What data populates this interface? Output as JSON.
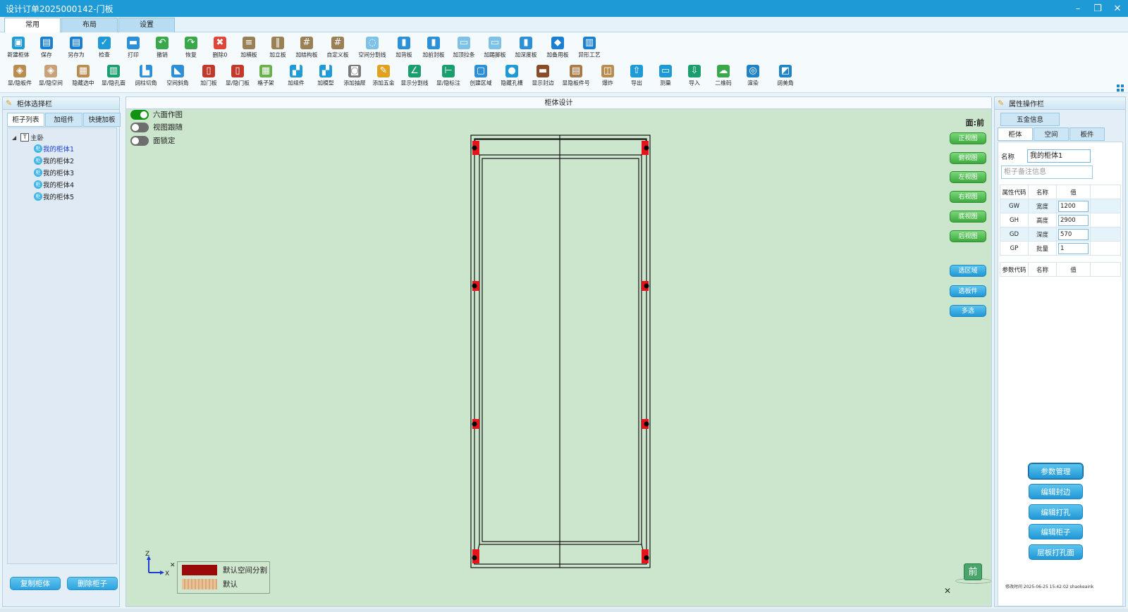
{
  "window": {
    "title": "设计订单2025000142-门板",
    "controls": [
      "–",
      "❐",
      "✕"
    ]
  },
  "ribbon_tabs": [
    "常用",
    "布局",
    "设置"
  ],
  "toolbar_row1": [
    {
      "label": "新建柜体",
      "icon": "new-cabinet-icon",
      "glyph": "▣",
      "color": "#1e9ad6"
    },
    {
      "label": "保存",
      "icon": "save-icon",
      "glyph": "▤",
      "color": "#1a7fd0"
    },
    {
      "label": "另存为",
      "icon": "save-as-icon",
      "glyph": "▤",
      "color": "#1a7fd0"
    },
    {
      "label": "检查",
      "icon": "check-icon",
      "glyph": "✓",
      "color": "#1e9ad6"
    },
    {
      "label": "打印",
      "icon": "print-icon",
      "glyph": "▬",
      "color": "#2d8fd6"
    },
    {
      "label": "撤销",
      "icon": "undo-icon",
      "glyph": "↶",
      "color": "#3aa84a"
    },
    {
      "label": "恢复",
      "icon": "redo-icon",
      "glyph": "↷",
      "color": "#3aa84a"
    },
    {
      "label": "删除0",
      "icon": "delete-icon",
      "glyph": "✖",
      "color": "#e0473a"
    },
    {
      "label": "加横板",
      "icon": "add-horizontal-board-icon",
      "glyph": "≡",
      "color": "#9a8055"
    },
    {
      "label": "加立板",
      "icon": "add-vertical-board-icon",
      "glyph": "‖",
      "color": "#9a8055"
    },
    {
      "label": "加结构板",
      "icon": "add-structure-board-icon",
      "glyph": "#",
      "color": "#9a8055"
    },
    {
      "label": "自定义板",
      "icon": "custom-board-icon",
      "glyph": "#",
      "color": "#9a8055"
    },
    {
      "label": "空间分割线",
      "icon": "space-divider-icon",
      "glyph": "◌",
      "color": "#7fc2e8"
    },
    {
      "label": "加背板",
      "icon": "add-back-board-icon",
      "glyph": "▮",
      "color": "#2d8fd6"
    },
    {
      "label": "加前封板",
      "icon": "add-front-seal-icon",
      "glyph": "▮",
      "color": "#2d8fd6"
    },
    {
      "label": "加顶拉条",
      "icon": "add-top-strip-icon",
      "glyph": "▭",
      "color": "#7fc2e8"
    },
    {
      "label": "加踢脚板",
      "icon": "add-skirting-icon",
      "glyph": "▭",
      "color": "#7fc2e8"
    },
    {
      "label": "加深度板",
      "icon": "add-depth-board-icon",
      "glyph": "▮",
      "color": "#2d8fd6"
    },
    {
      "label": "加备用板",
      "icon": "add-spare-board-icon",
      "glyph": "◆",
      "color": "#1a7fd0"
    },
    {
      "label": "异形工艺",
      "icon": "special-shape-icon",
      "glyph": "▥",
      "color": "#1a7fd0"
    }
  ],
  "toolbar_row2": [
    {
      "label": "显/隐板件",
      "icon": "toggle-boards-icon",
      "glyph": "◈",
      "color": "#b98c4f"
    },
    {
      "label": "显/隐空间",
      "icon": "toggle-space-icon",
      "glyph": "◈",
      "color": "#c9a27a"
    },
    {
      "label": "隐藏选中",
      "icon": "hide-selected-icon",
      "glyph": "▦",
      "color": "#b98c4f"
    },
    {
      "label": "显/隐孔面",
      "icon": "toggle-hole-face-icon",
      "glyph": "▥",
      "color": "#1a9e6e"
    },
    {
      "label": "阔柱切角",
      "icon": "column-chamfer-icon",
      "glyph": "▙",
      "color": "#2d8fd6"
    },
    {
      "label": "空间斜角",
      "icon": "space-bevel-icon",
      "glyph": "◣",
      "color": "#2d8fd6"
    },
    {
      "label": "加门板",
      "icon": "add-door-icon",
      "glyph": "▯",
      "color": "#c0392b"
    },
    {
      "label": "显/隐门板",
      "icon": "toggle-door-icon",
      "glyph": "▯",
      "color": "#c0392b"
    },
    {
      "label": "格子架",
      "icon": "grid-shelf-icon",
      "glyph": "▦",
      "color": "#6ab04c"
    },
    {
      "label": "加组件",
      "icon": "add-component-icon",
      "glyph": "▞",
      "color": "#1e9ad6"
    },
    {
      "label": "加模型",
      "icon": "add-model-icon",
      "glyph": "▞",
      "color": "#1e9ad6"
    },
    {
      "label": "添加抽屉",
      "icon": "add-drawer-icon",
      "glyph": "◙",
      "color": "#7a7a7a"
    },
    {
      "label": "添加五金",
      "icon": "add-hardware-icon",
      "glyph": "✎",
      "color": "#e0a020"
    },
    {
      "label": "显示分割线",
      "icon": "show-divider-icon",
      "glyph": "∠",
      "color": "#1a9e6e"
    },
    {
      "label": "显/隐标注",
      "icon": "toggle-dimension-icon",
      "glyph": "⊢",
      "color": "#1a9e6e"
    },
    {
      "label": "创建区域",
      "icon": "create-area-icon",
      "glyph": "▢",
      "color": "#2d8fd6"
    },
    {
      "label": "隐藏孔槽",
      "icon": "hide-holes-icon",
      "glyph": "●",
      "color": "#1e9ad6"
    },
    {
      "label": "显示封边",
      "icon": "show-edge-icon",
      "glyph": "▬",
      "color": "#8a4b2a"
    },
    {
      "label": "显隐板件号",
      "icon": "toggle-board-number-icon",
      "glyph": "▤",
      "color": "#a87b4a"
    },
    {
      "label": "爆炸",
      "icon": "explode-icon",
      "glyph": "◫",
      "color": "#b98c4f"
    },
    {
      "label": "导出",
      "icon": "export-icon",
      "glyph": "⇧",
      "color": "#1e9ad6"
    },
    {
      "label": "测量",
      "icon": "measure-icon",
      "glyph": "▭",
      "color": "#1e9ad6"
    },
    {
      "label": "导入",
      "icon": "import-icon",
      "glyph": "⇩",
      "color": "#1a9e6e"
    },
    {
      "label": "二维码",
      "icon": "qrcode-icon",
      "glyph": "☁",
      "color": "#3aa84a"
    },
    {
      "label": "渲染",
      "icon": "render-icon",
      "glyph": "◎",
      "color": "#1e84c6"
    },
    {
      "label": "阔美角",
      "icon": "beauty-corner-icon",
      "glyph": "◩",
      "color": "#1e84c6"
    }
  ],
  "left_panel": {
    "title": "柜体选择栏",
    "tabs": [
      "柜子列表",
      "加组件",
      "快捷加板"
    ],
    "tree_root": "主卧",
    "tree_items": [
      "我的柜体1",
      "我的柜体2",
      "我的柜体3",
      "我的柜体4",
      "我的柜体5"
    ],
    "copy_button": "复制柜体",
    "delete_button": "删除柜子"
  },
  "center": {
    "title": "柜体设计",
    "toggles": [
      {
        "label": "六面作图",
        "on": true
      },
      {
        "label": "视图跟随",
        "on": false
      },
      {
        "label": "面锁定",
        "on": false
      }
    ],
    "face_label": "面:前",
    "view_buttons": [
      "正视图",
      "俯视图",
      "左视图",
      "右视图",
      "底视图",
      "后视图"
    ],
    "select_buttons": [
      "选区域",
      "选板件",
      "多选"
    ],
    "axis": {
      "z": "Z",
      "x": "X",
      "close": "✕"
    },
    "legend": [
      {
        "label": "默认空间分割",
        "color": "#9a0a0a"
      },
      {
        "label": "默认",
        "color": "#e3b98a"
      }
    ],
    "front_cube": "前",
    "close": "✕"
  },
  "right_panel": {
    "title": "属性操作栏",
    "top_tab": "五金信息",
    "tabs": [
      "柜体",
      "空间",
      "板件"
    ],
    "name_label": "名称",
    "name_value": "我的柜体1",
    "note_placeholder": "柜子备注信息",
    "attr_headers": [
      "属性代码",
      "名称",
      "值"
    ],
    "attrs": [
      {
        "code": "GW",
        "name": "宽度",
        "value": "1200"
      },
      {
        "code": "GH",
        "name": "高度",
        "value": "2900"
      },
      {
        "code": "GD",
        "name": "深度",
        "value": "570"
      },
      {
        "code": "GP",
        "name": "批量",
        "value": "1"
      }
    ],
    "param_headers": [
      "参数代码",
      "名称",
      "值"
    ],
    "buttons": [
      "参数管理",
      "编辑封边",
      "编辑打孔",
      "编辑柜子",
      "层板打孔面"
    ],
    "mod_time": "修改时间 2025-06-25 15:42:02 shaokeaink"
  }
}
